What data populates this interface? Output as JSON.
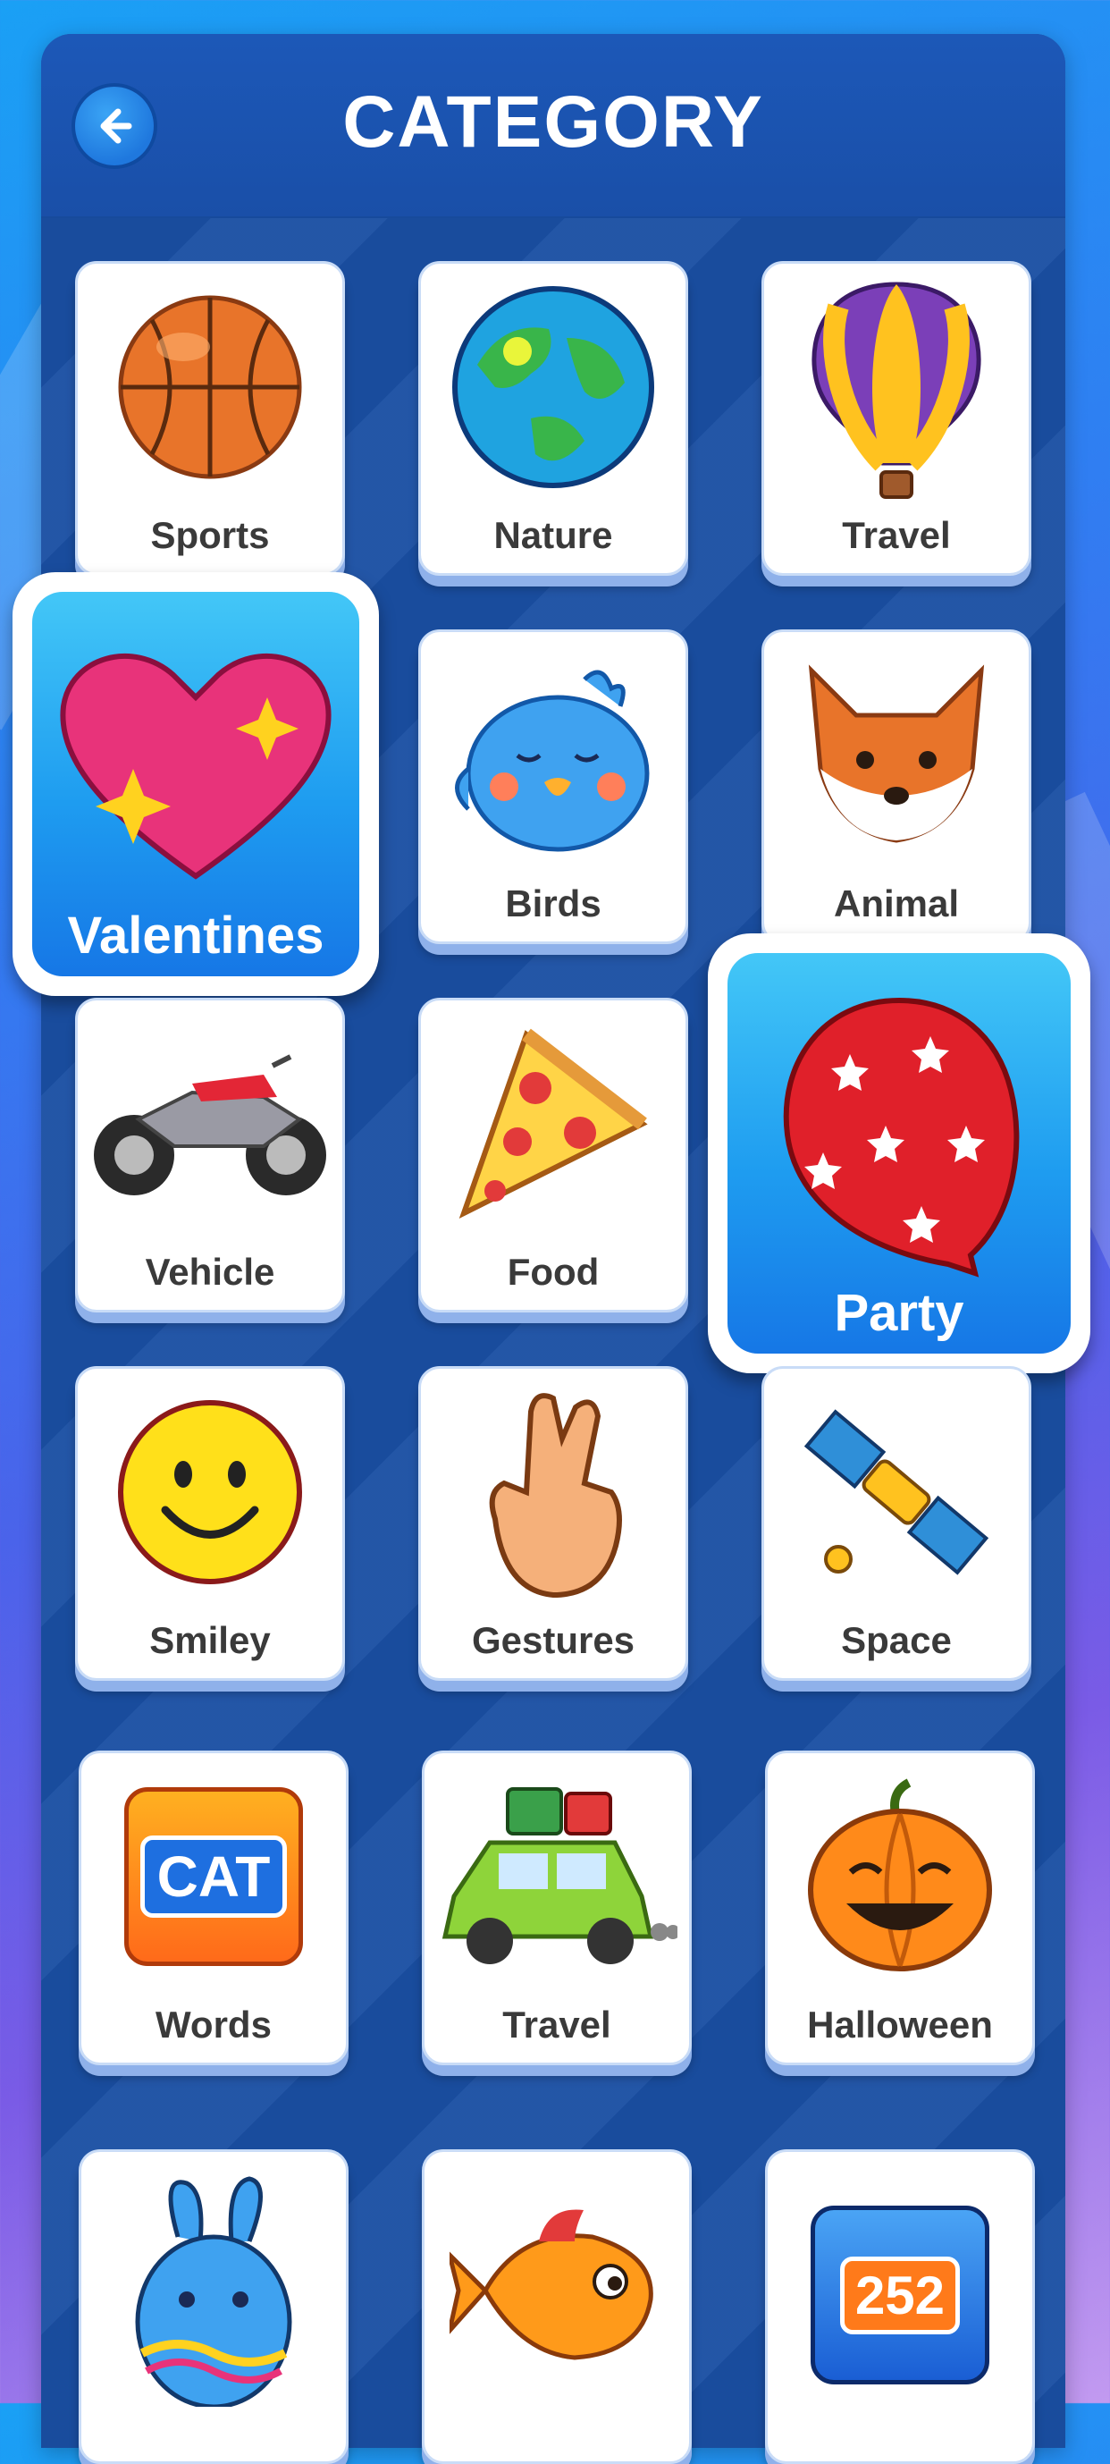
{
  "header": {
    "title": "CATEGORY"
  },
  "categories": [
    {
      "label": "Sports",
      "icon": "basketball-icon"
    },
    {
      "label": "Nature",
      "icon": "earth-icon"
    },
    {
      "label": "Travel",
      "icon": "hot-air-balloon-icon"
    },
    {
      "label": "Valentines",
      "icon": "heart-icon",
      "selected": true
    },
    {
      "label": "Birds",
      "icon": "bird-icon"
    },
    {
      "label": "Animal",
      "icon": "fox-icon"
    },
    {
      "label": "Vehicle",
      "icon": "motorcycle-icon"
    },
    {
      "label": "Food",
      "icon": "pizza-icon"
    },
    {
      "label": "Party",
      "icon": "balloon-icon",
      "selected": true
    },
    {
      "label": "Smiley",
      "icon": "smiley-icon"
    },
    {
      "label": "Gestures",
      "icon": "crossed-fingers-icon"
    },
    {
      "label": "Space",
      "icon": "satellite-icon"
    },
    {
      "label": "Words",
      "icon": "word-cat-icon",
      "icon_text": "CAT"
    },
    {
      "label": "Travel",
      "icon": "car-luggage-icon"
    },
    {
      "label": "Halloween",
      "icon": "pumpkin-icon"
    },
    {
      "label": "",
      "icon": "easter-egg-bunny-icon"
    },
    {
      "label": "",
      "icon": "fish-icon"
    },
    {
      "label": "",
      "icon": "numbers-icon",
      "icon_text": "252"
    }
  ]
}
